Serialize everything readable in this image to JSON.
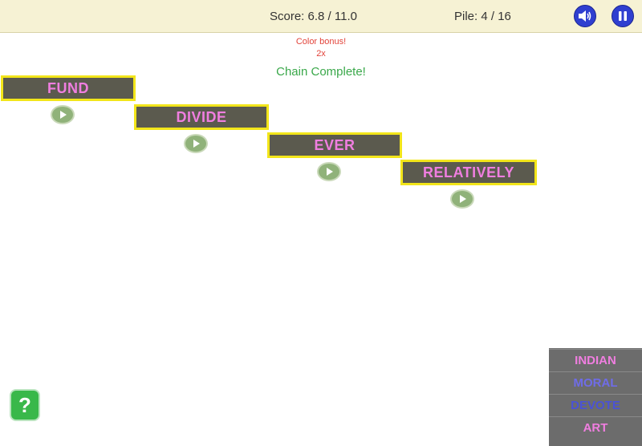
{
  "hud": {
    "score_text": "Score: 6.8 / 11.0",
    "pile_text": "Pile: 4 / 16",
    "sound_icon": "speaker-icon",
    "pause_icon": "pause-icon"
  },
  "messages": {
    "bonus_label": "Color bonus!",
    "bonus_multiplier": "2x",
    "chain": "Chain Complete!"
  },
  "chain_words": [
    {
      "word": "FUND"
    },
    {
      "word": "DIVIDE"
    },
    {
      "word": "EVER"
    },
    {
      "word": "RELATIVELY"
    }
  ],
  "pile_words": [
    {
      "word": "INDIAN",
      "color": "#f07ee0"
    },
    {
      "word": "MORAL",
      "color": "#6f6ce8"
    },
    {
      "word": "DEVOTE",
      "color": "#4a52d6"
    },
    {
      "word": "ART",
      "color": "#f07ee0"
    }
  ],
  "help": {
    "label": "?"
  },
  "colors": {
    "tile_border": "#f2e51a",
    "tile_bg": "#5b5a4e",
    "word_pink": "#f07ee0",
    "chain_green": "#3aa84a"
  }
}
